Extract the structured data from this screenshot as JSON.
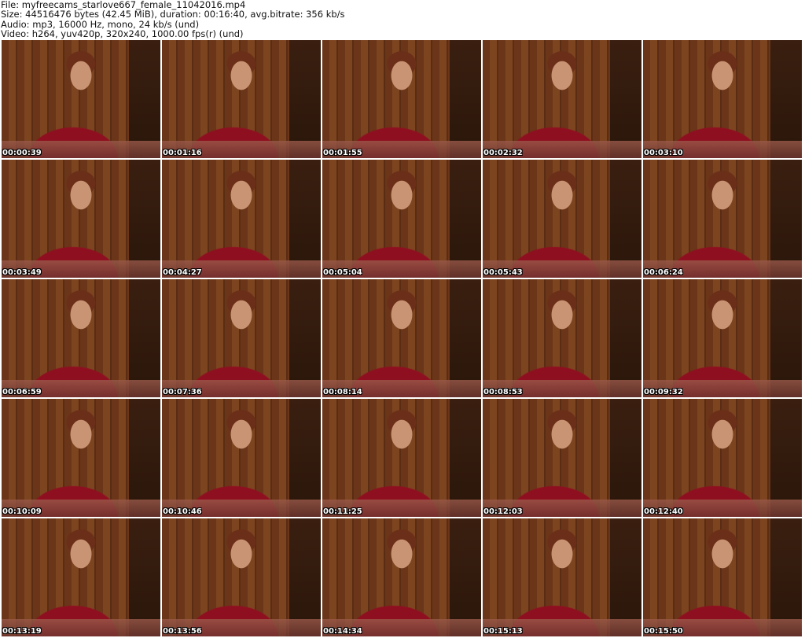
{
  "header": {
    "file": "File: myfreecams_starlove667_female_11042016.mp4",
    "size": "Size: 44516476 bytes (42.45 MiB), duration: 00:16:40, avg.bitrate: 356 kb/s",
    "audio": "Audio: mp3, 16000 Hz, mono, 24 kb/s (und)",
    "video": "Video: h264, yuv420p, 320x240, 1000.00 fps(r) (und)"
  },
  "timestamps": [
    "00:00:39",
    "00:01:16",
    "00:01:55",
    "00:02:32",
    "00:03:10",
    "00:03:49",
    "00:04:27",
    "00:05:04",
    "00:05:43",
    "00:06:24",
    "00:06:59",
    "00:07:36",
    "00:08:14",
    "00:08:53",
    "00:09:32",
    "00:10:09",
    "00:10:46",
    "00:11:25",
    "00:12:03",
    "00:12:40",
    "00:13:19",
    "00:13:56",
    "00:14:34",
    "00:15:13",
    "00:15:50"
  ]
}
